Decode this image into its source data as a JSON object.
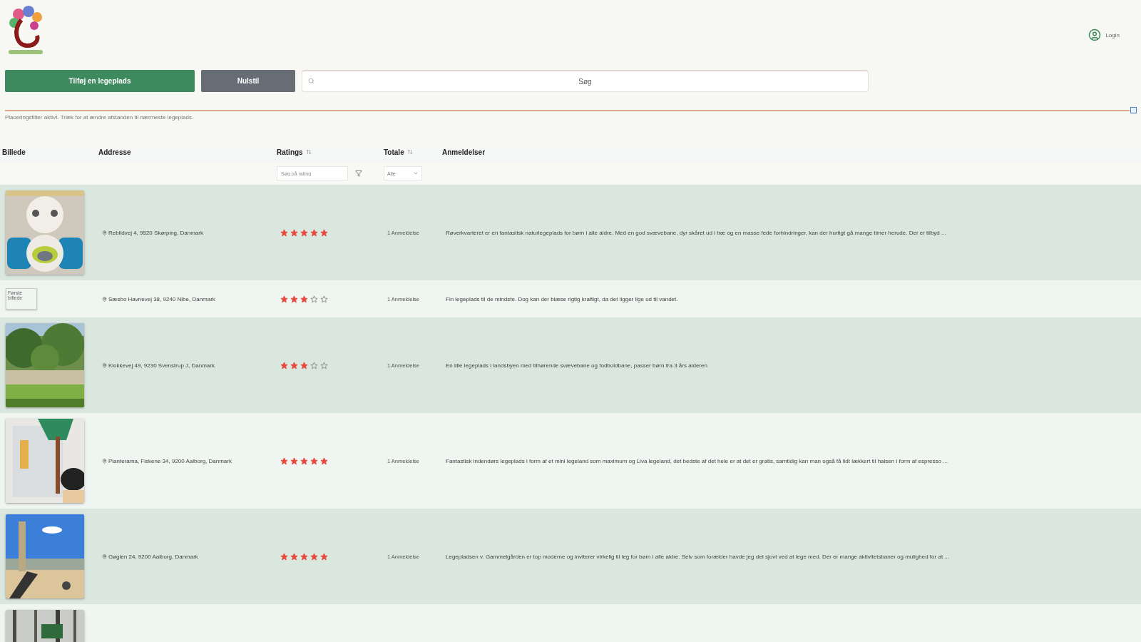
{
  "header": {
    "account_label": "Login"
  },
  "toolbar": {
    "add_button": "Tilføj en legeplads",
    "reset_button": "Nulstil",
    "search": {
      "placeholder": "Søg"
    }
  },
  "distance_slider": {
    "level": 1,
    "hint": "Placeringsfilter aktivt. Træk for at ændre afstanden til nærmeste legeplads."
  },
  "table": {
    "columns": [
      {
        "label": "Billede",
        "kind": "plain"
      },
      {
        "label": "Addresse",
        "kind": "plain"
      },
      {
        "label": "Ratings",
        "kind": "sortable"
      },
      {
        "label": "Totale",
        "kind": "sortable"
      },
      {
        "label": "Anmeldelser",
        "kind": "plain"
      }
    ],
    "filters": {
      "rating_placeholder": "Søg på rating",
      "total_value": "Alle"
    },
    "rows": [
      {
        "image": {
          "kind": "picture"
        },
        "address": "Rebildvej 4, 9520 Skørping, Danmark",
        "stars": 5,
        "total": "1 Anmeldelse",
        "review": "Røverkvarteret er en fantastisk naturlegeplads for børn i alle aldre. Med en god svævebane, dyr skåret ud i træ og en masse fede forhindringer, kan der hurtigt gå mange timer herude. Der er tilbyd ..."
      },
      {
        "image": {
          "kind": "broken",
          "alt": "Første billede"
        },
        "address": "Sæsbo Havnevej 38, 9240 Nibe, Danmark",
        "stars": 3,
        "total": "1 Anmeldelse",
        "review": "Fin legeplads til de mindste. Dog kan der blæse rigtig kraftigt, da det ligger lige ud til vandet."
      },
      {
        "image": {
          "kind": "picture"
        },
        "address": "Klokkevej 49, 9230 Svenstrup J, Danmark",
        "stars": 3,
        "total": "1 Anmeldelse",
        "review": "En lille legeplads i landsbyen med tilhørende svævebane og fodboldbane, passer børn fra 3 års alderen"
      },
      {
        "image": {
          "kind": "picture"
        },
        "address": "Planterama, Fiskene 34, 9200 Aalborg, Danmark",
        "stars": 5,
        "total": "1 Anmeldelse",
        "review": "Fantastisk indendørs legeplads i form af et mini legeland som maximum og Liva legeland, det bedste af det hele er at det er gratis, samtidig kan man også få lidt lækkert til halsen i form af espresso ..."
      },
      {
        "image": {
          "kind": "picture"
        },
        "address": "Gøglen 24, 9200 Aalborg, Danmark",
        "stars": 5,
        "total": "1 Anmeldelse",
        "review": "Legepladsen v. Gammelgården er top moderne og inviterer virkelig til leg for børn i alle aldre. Selv som forælder havde jeg det sjovt ved at lege med. Der er mange aktivitetsbaner og mulighed for at ..."
      },
      {
        "image": {
          "kind": "picture"
        }
      }
    ]
  }
}
